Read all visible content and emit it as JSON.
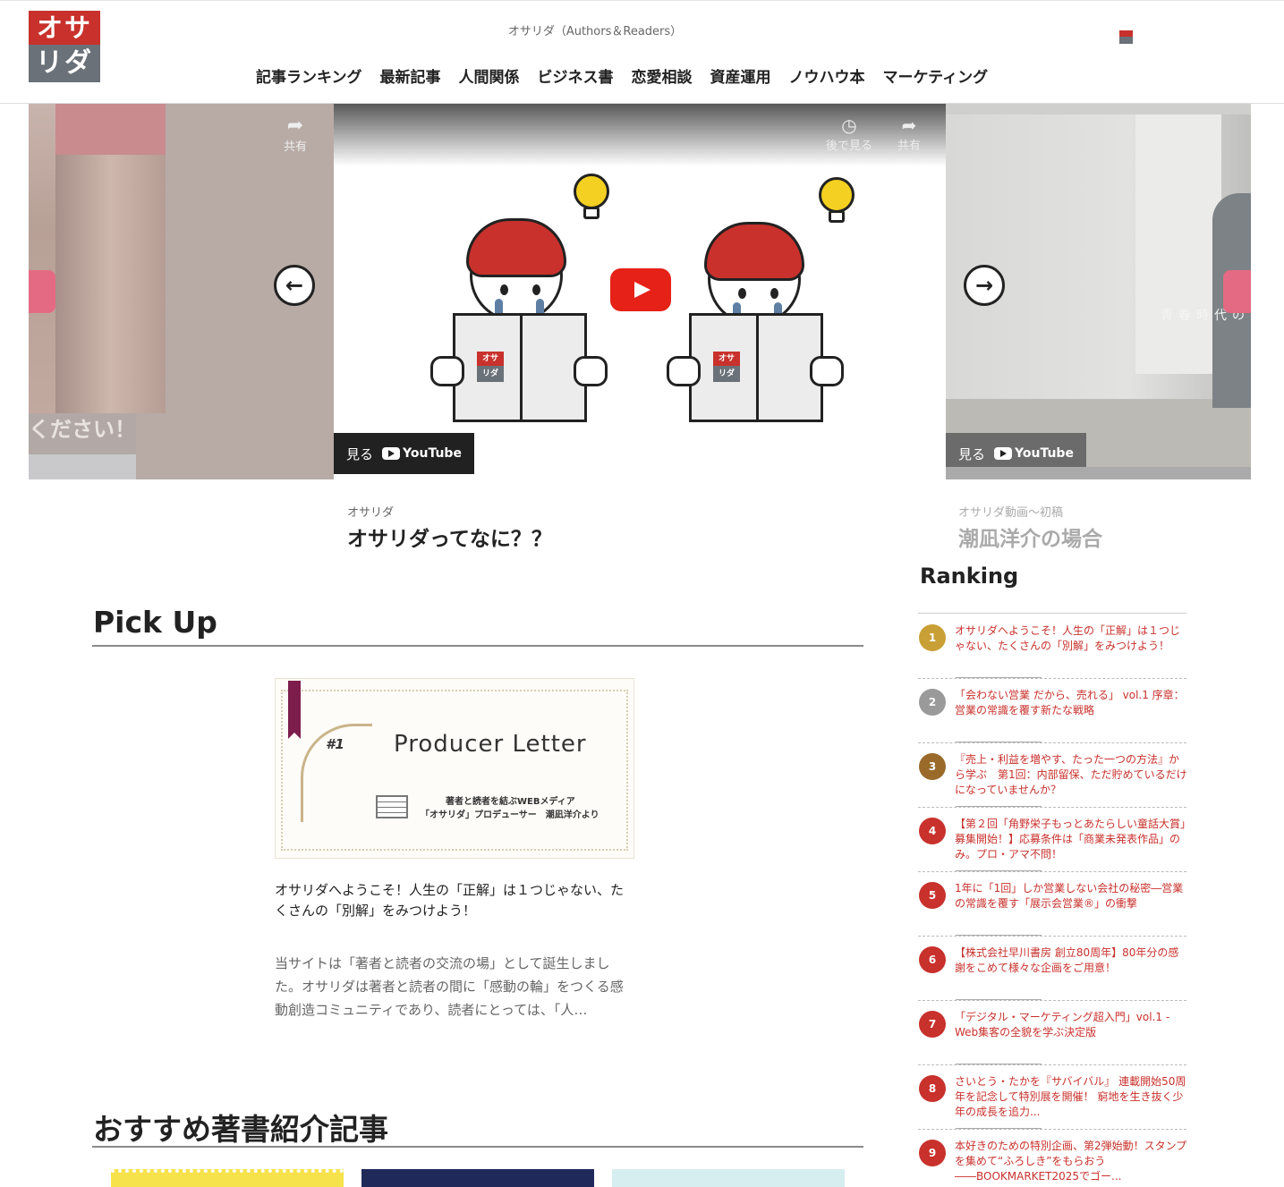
{
  "header": {
    "logo_top": "オサ",
    "logo_bottom": "リダ",
    "tagline": "オサリダ（Authors＆Readers）",
    "nav": [
      "記事ランキング",
      "最新記事",
      "人間関係",
      "ビジネス書",
      "恋愛相談",
      "資産運用",
      "ノウハウ本",
      "マーケティング"
    ]
  },
  "carousel": {
    "left": {
      "caption": "ください！",
      "share_label": "共有"
    },
    "center": {
      "watch_later": "後で見る",
      "share_label": "共有",
      "watch_label": "見る",
      "youtube_label": "YouTube",
      "book_label_top": "オサ",
      "book_label_bottom": "リダ"
    },
    "right": {
      "caption": "青春時代の",
      "watch_label": "見る",
      "youtube_label": "YouTube"
    },
    "prev_icon": "arrow-left-icon",
    "next_icon": "arrow-right-icon"
  },
  "video_captions": [
    {
      "category": "オサリダ",
      "title": "オサリダってなに？？"
    },
    {
      "category": "オサリダ動画～初稿",
      "title": "潮凪洋介の場合"
    }
  ],
  "pickup": {
    "section_title": "Pick Up",
    "card_number": "#1",
    "card_title": "Producer Letter",
    "card_sub1": "著者と読者を結ぶWEBメディア",
    "card_sub2": "「オサリダ」プロデューサー　潮凪洋介より",
    "heading": "オサリダへようこそ！人生の「正解」は１つじゃない、たくさんの「別解」をみつけよう！",
    "excerpt": "当サイトは「著者と読者の交流の場」として誕生しました。オサリダは著者と読者の間に「感動の輪」をつくる感動創造コミュニティであり、読者にとっては、「人…"
  },
  "recommend": {
    "section_title": "おすすめ著書紹介記事"
  },
  "ranking": {
    "title": "Ranking",
    "items": [
      {
        "rank": "1",
        "color": "#c9a035",
        "text": "オサリダへようこそ！人生の「正解」は１つじゃない、たくさんの「別解」をみつけよう！"
      },
      {
        "rank": "2",
        "color": "#9a9a9a",
        "text": "「会わない営業 だから、売れる」 vol.1 序章：営業の常識を覆す新たな戦略"
      },
      {
        "rank": "3",
        "color": "#9a6a2a",
        "text": "『売上・利益を増やす、たった一つの方法』から学ぶ　第1回：内部留保、ただ貯めているだけになっていませんか？"
      },
      {
        "rank": "4",
        "color": "#c8312c",
        "text": "【第２回「角野栄子もっとあたらしい童話大賞」募集開始！】応募条件は「商業未発表作品」のみ。プロ・アマ不問！"
      },
      {
        "rank": "5",
        "color": "#c8312c",
        "text": "1年に「1回」しか営業しない会社の秘密―営業の常識を覆す「展示会営業®」の衝撃"
      },
      {
        "rank": "6",
        "color": "#c8312c",
        "text": "【株式会社早川書房 創立80周年】80年分の感謝をこめて様々な企画をご用意！"
      },
      {
        "rank": "7",
        "color": "#c8312c",
        "text": "「デジタル・マーケティング超入門」vol.1 - Web集客の全貌を学ぶ決定版"
      },
      {
        "rank": "8",
        "color": "#c8312c",
        "text": "さいとう・たかを『サバイバル』 連載開始50周年を記念して特別展を開催！ 窮地を生き抜く少年の成長を追力..."
      },
      {
        "rank": "9",
        "color": "#c8312c",
        "text": "本好きのための特別企画、第2弾始動！スタンプを集めて“ふろしき”をもらおう――BOOKMARKET2025でゴー..."
      }
    ]
  }
}
